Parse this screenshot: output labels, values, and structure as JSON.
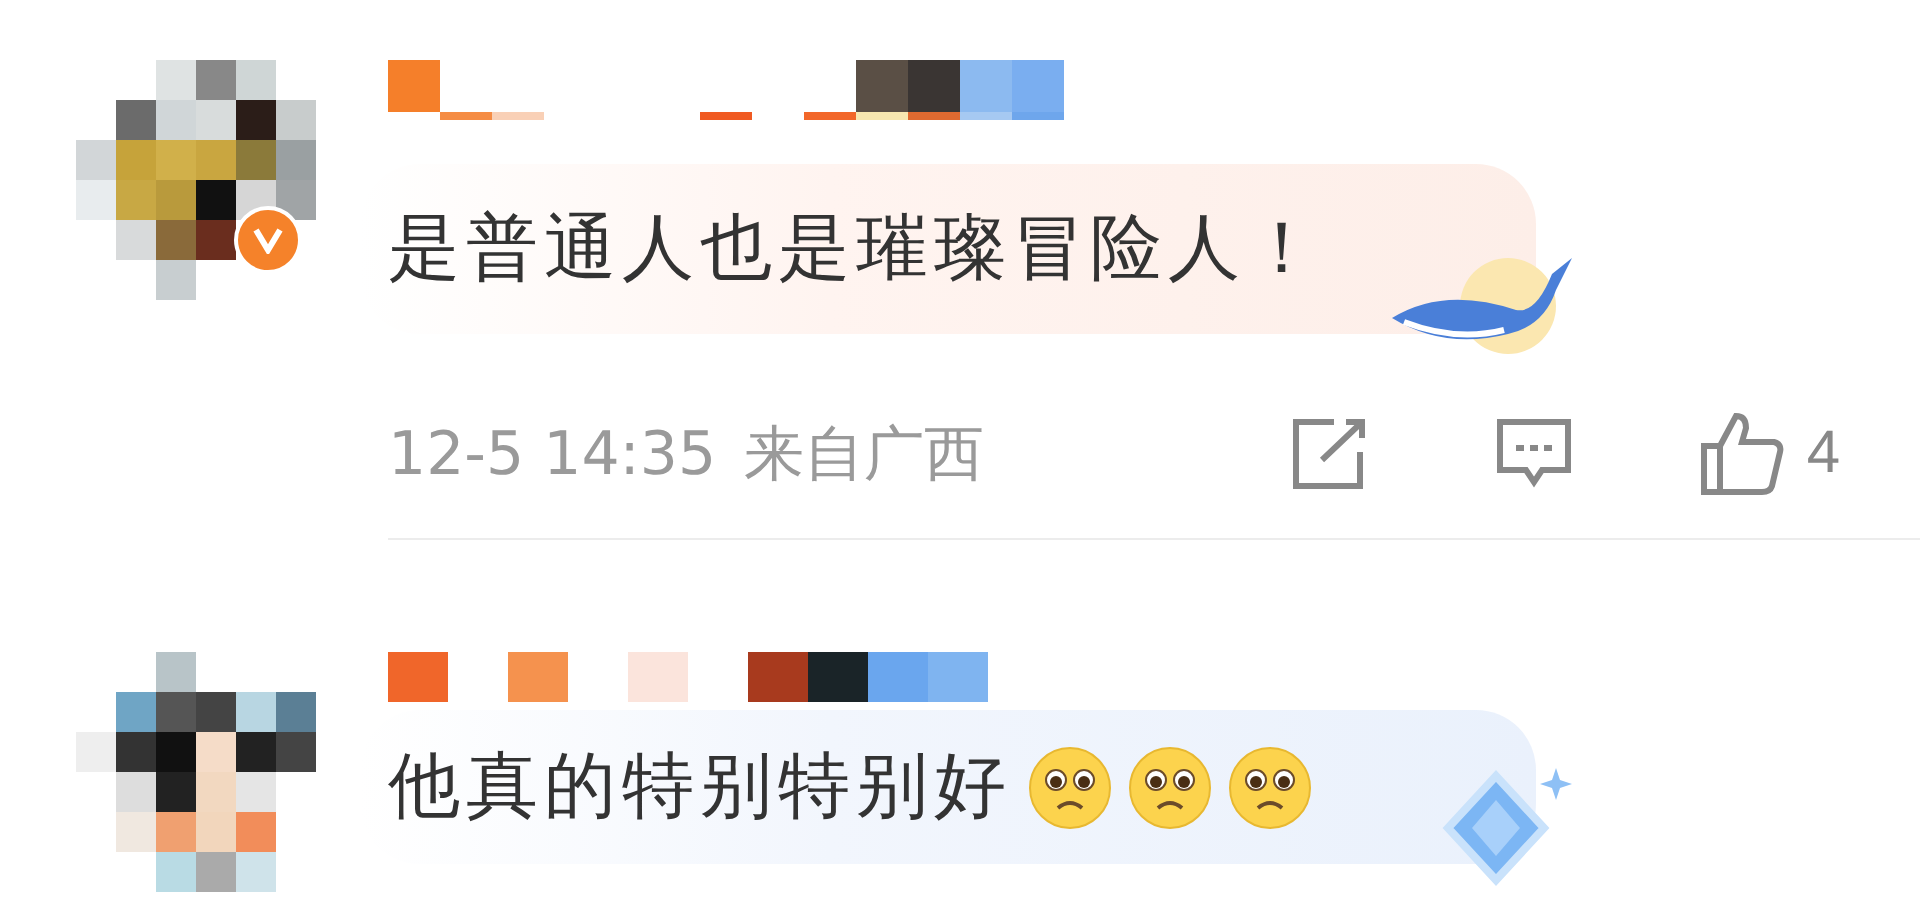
{
  "comments": [
    {
      "text": "是普通人也是璀璨冒险人！",
      "verified": true,
      "kind": "whale",
      "meta": {
        "time": "12-5 14:35",
        "location": "来自广西",
        "likes": "4"
      }
    },
    {
      "text": "他真的特别特别好",
      "verified": false,
      "kind": "diamond",
      "emojis": [
        {
          "kind": "pleading"
        },
        {
          "kind": "pleading"
        },
        {
          "kind": "pleading"
        }
      ]
    }
  ]
}
